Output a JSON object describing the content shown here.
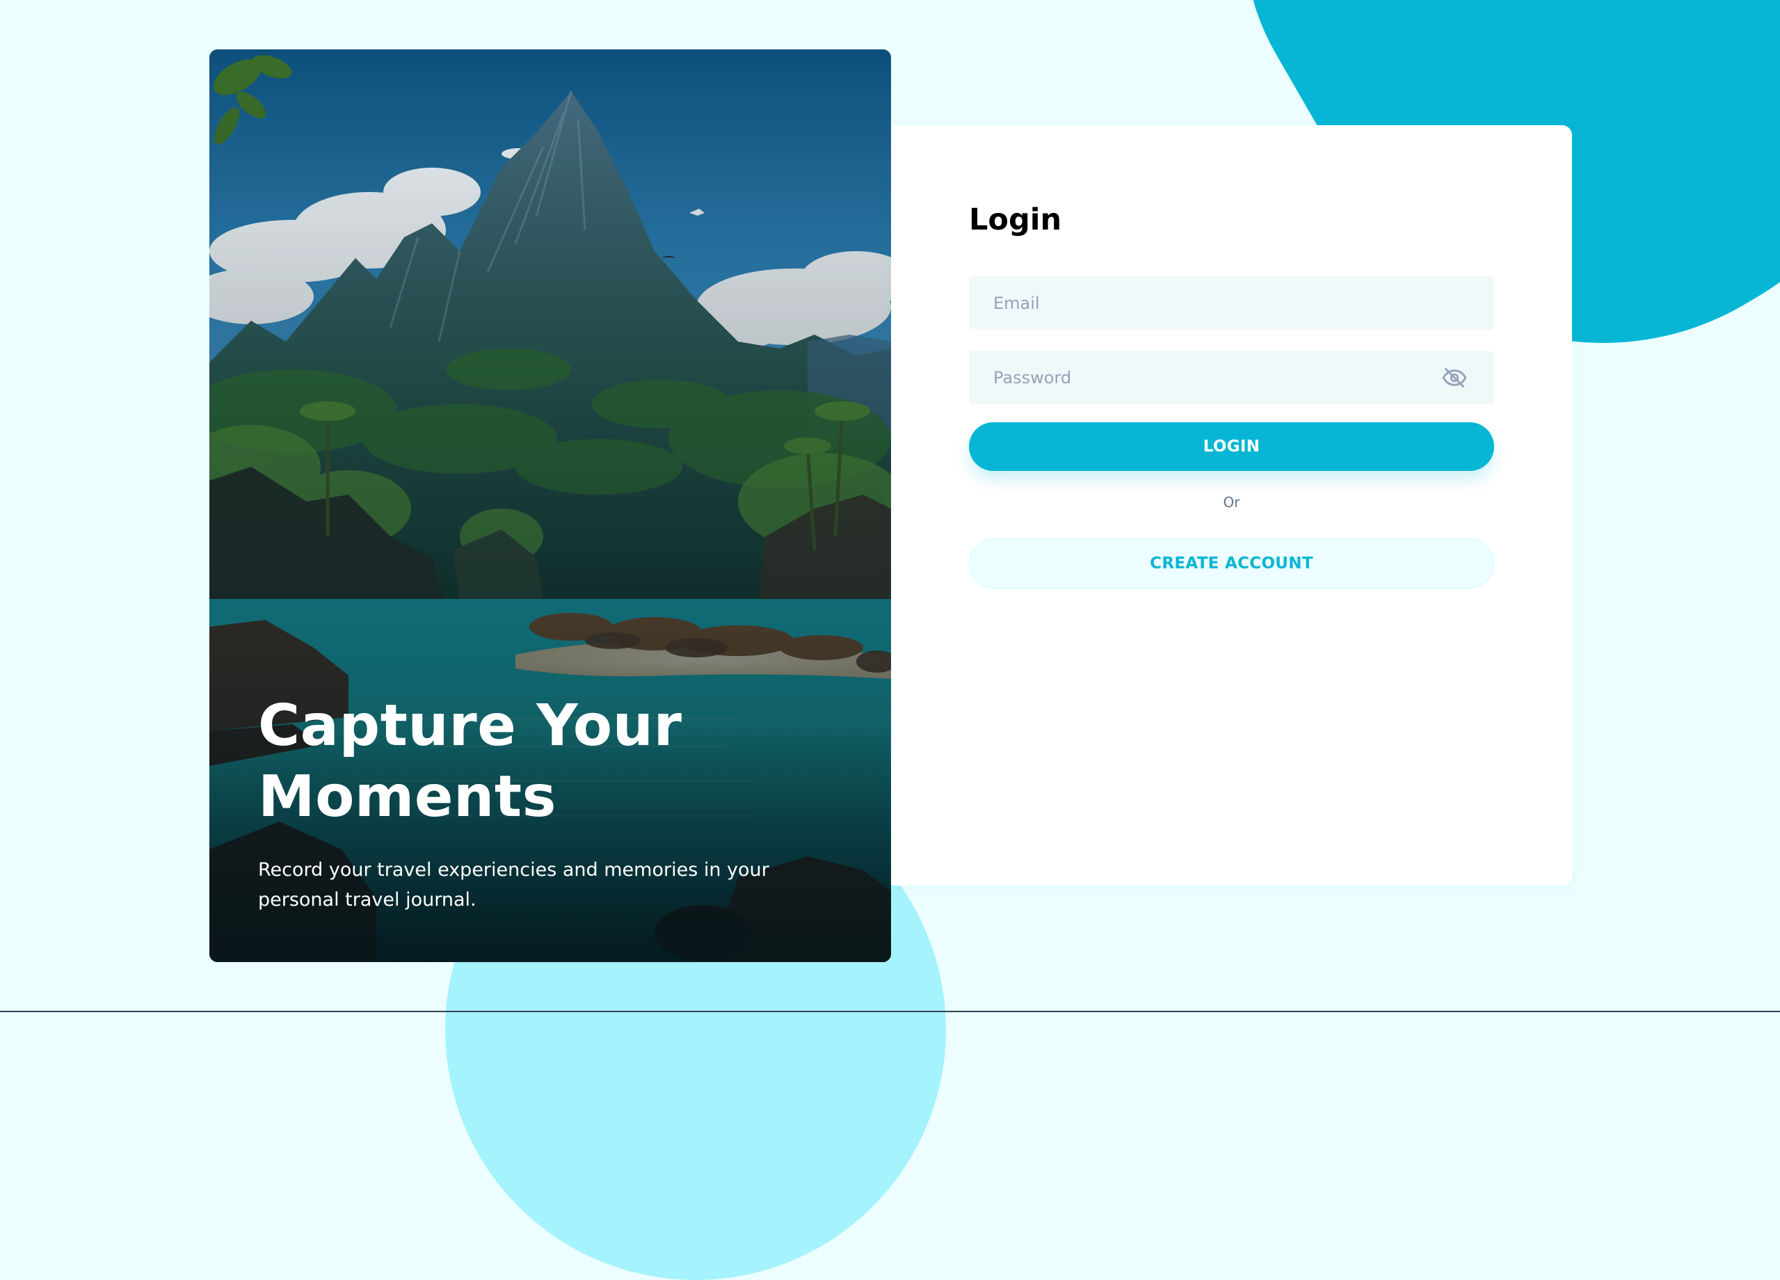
{
  "hero": {
    "title": "Capture Your Moments",
    "subtitle": "Record your travel experiencies and memories in your personal travel journal."
  },
  "login": {
    "title": "Login",
    "email_placeholder": "Email",
    "password_placeholder": "Password",
    "login_button": "LOGIN",
    "or_text": "Or",
    "create_account_button": "CREATE ACCOUNT"
  },
  "icons": {
    "password_toggle": "eye-off-icon"
  },
  "colors": {
    "accent": "#06b6d4",
    "background": "#ecfeff",
    "blob_light": "#a5f3fc",
    "input_background": "#f1f8fa",
    "create_account_background": "#ecfeff"
  }
}
